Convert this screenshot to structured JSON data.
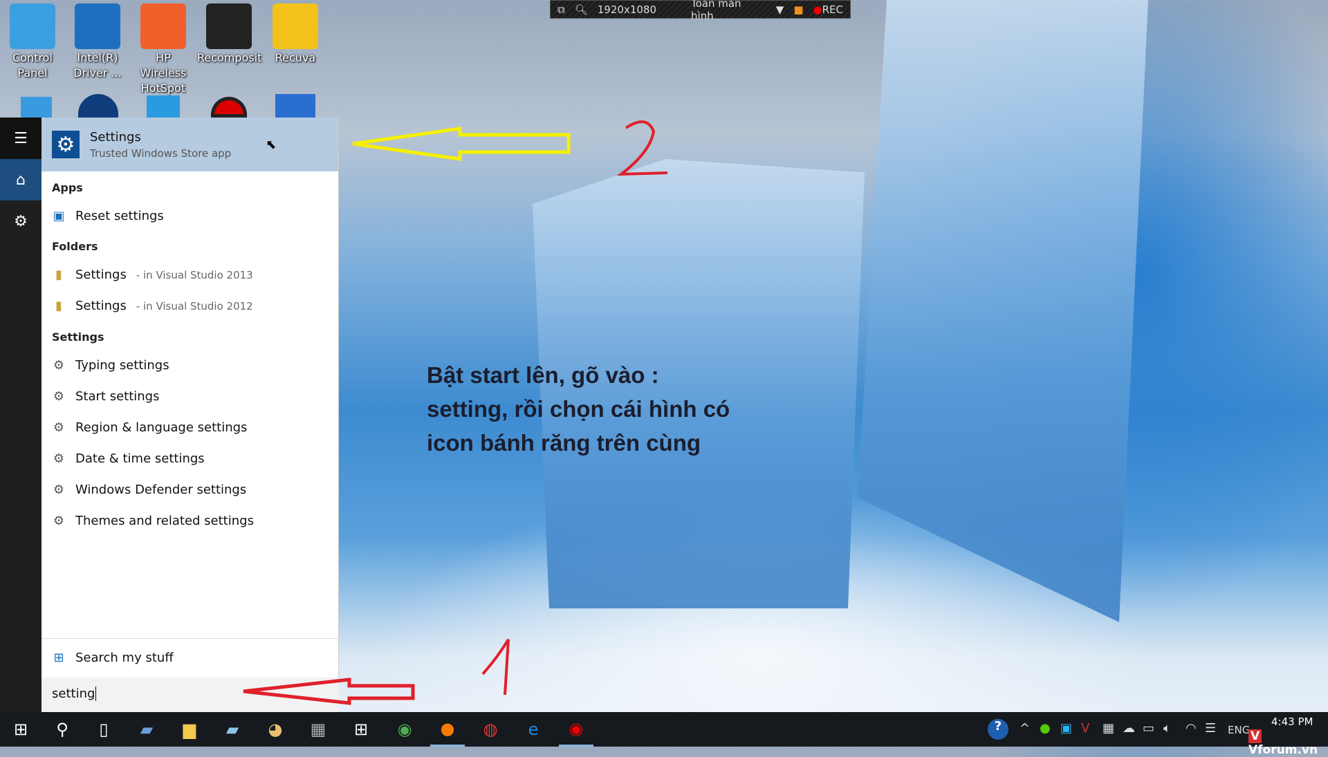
{
  "desktop": {
    "icons": [
      {
        "label": "Control Panel",
        "color": "#3aa0e0"
      },
      {
        "label": "Intel(R) Driver ...",
        "color": "#1f6fc0"
      },
      {
        "label": "HP Wireless HotSpot",
        "color": "#f0602a"
      },
      {
        "label": "Recomposit",
        "color": "#222222"
      },
      {
        "label": "Recuva",
        "color": "#f3c21a"
      }
    ]
  },
  "recorder": {
    "resolution": "1920x1080",
    "mode": "Toàn màn hình",
    "rec": "REC"
  },
  "start": {
    "top_result": {
      "title": "Settings",
      "subtitle": "Trusted Windows Store app"
    },
    "sections": {
      "apps": "Apps",
      "folders": "Folders",
      "settings": "Settings"
    },
    "apps": [
      {
        "label": "Reset settings"
      }
    ],
    "folders": [
      {
        "label": "Settings",
        "location": "- in Visual Studio 2013"
      },
      {
        "label": "Settings",
        "location": "- in Visual Studio 2012"
      }
    ],
    "settings": [
      {
        "label": "Typing settings"
      },
      {
        "label": "Start settings"
      },
      {
        "label": "Region & language settings"
      },
      {
        "label": "Date & time settings"
      },
      {
        "label": "Windows Defender settings"
      },
      {
        "label": "Themes and related settings"
      }
    ],
    "search_my_stuff": "Search my stuff",
    "search_value": "setting"
  },
  "annotation": {
    "lines": [
      "Bật start lên, gõ vào :",
      "setting, rồi chọn cái hình có",
      "icon bánh răng trên cùng"
    ],
    "marker_1": "1",
    "marker_2": "2"
  },
  "tray": {
    "language": "ENG",
    "time": "4:43 PM",
    "watermark": "Vforum.vn"
  },
  "colors": {
    "accent": "#0e4f94",
    "highlight": "#b5cbe0",
    "arrow_yellow": "#f5f000",
    "arrow_red": "#e0202a"
  }
}
